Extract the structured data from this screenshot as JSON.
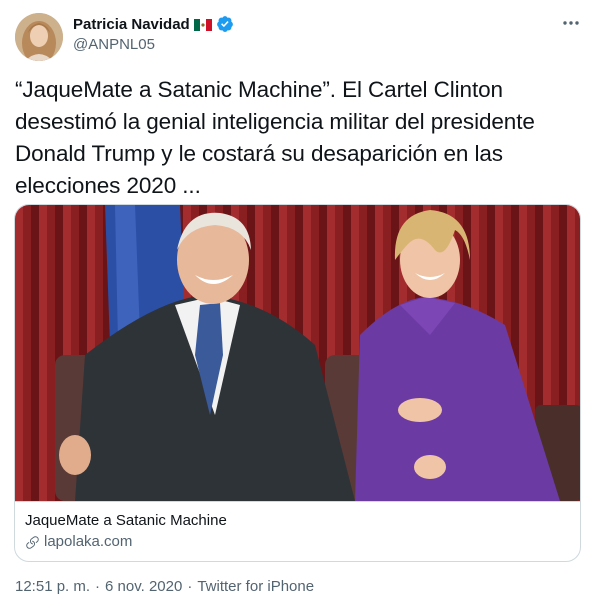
{
  "author": {
    "display_name": "Patricia Navidad",
    "handle": "@ANPNL05",
    "flag_icon": "mexico-flag-icon",
    "verified_icon": "verified-badge-icon"
  },
  "tweet": {
    "text": "“JaqueMate a Satanic Machine”. El Cartel Clinton desestimó la genial inteligencia militar del presidente Donald Trump y le costará su desaparición en las elecciones 2020 ..."
  },
  "card": {
    "title": "JaqueMate a Satanic Machine",
    "domain": "lapolaka.com",
    "link_icon": "link-icon"
  },
  "meta": {
    "time": "12:51 p. m.",
    "separator1": "·",
    "date": "6 nov. 2020",
    "separator2": "·",
    "source": "Twitter for iPhone"
  },
  "colors": {
    "verified": "#1d9bf0",
    "secondary_text": "#536471",
    "card_border": "#cfd9de"
  }
}
